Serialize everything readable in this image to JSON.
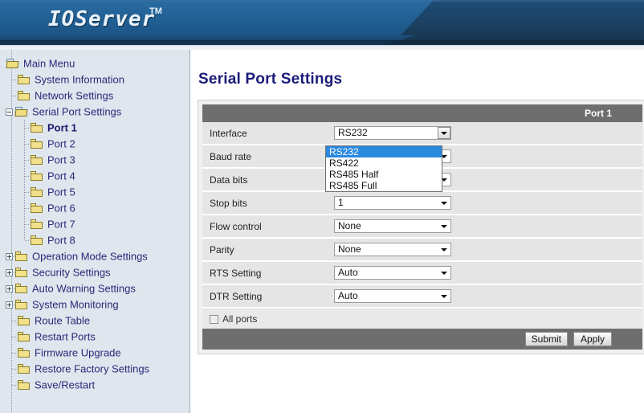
{
  "header": {
    "logo_text": "IOServer",
    "trademark": "TM"
  },
  "sidebar": {
    "items": [
      {
        "label": "Main Menu",
        "level": 0,
        "icon": "open-folder-icon",
        "expander": "none",
        "selected": false
      },
      {
        "label": "System Information",
        "level": 1,
        "icon": "folder-icon",
        "expander": "none",
        "selected": false
      },
      {
        "label": "Network Settings",
        "level": 1,
        "icon": "folder-icon",
        "expander": "none",
        "selected": false
      },
      {
        "label": "Serial Port Settings",
        "level": 1,
        "icon": "open-folder-icon",
        "expander": "minus",
        "selected": false
      },
      {
        "label": "Port 1",
        "level": 2,
        "icon": "folder-icon",
        "expander": "none",
        "selected": true
      },
      {
        "label": "Port 2",
        "level": 2,
        "icon": "folder-icon",
        "expander": "none",
        "selected": false
      },
      {
        "label": "Port 3",
        "level": 2,
        "icon": "folder-icon",
        "expander": "none",
        "selected": false
      },
      {
        "label": "Port 4",
        "level": 2,
        "icon": "folder-icon",
        "expander": "none",
        "selected": false
      },
      {
        "label": "Port 5",
        "level": 2,
        "icon": "folder-icon",
        "expander": "none",
        "selected": false
      },
      {
        "label": "Port 6",
        "level": 2,
        "icon": "folder-icon",
        "expander": "none",
        "selected": false
      },
      {
        "label": "Port 7",
        "level": 2,
        "icon": "folder-icon",
        "expander": "none",
        "selected": false
      },
      {
        "label": "Port 8",
        "level": 2,
        "icon": "folder-icon",
        "expander": "none",
        "selected": false
      },
      {
        "label": "Operation Mode Settings",
        "level": 1,
        "icon": "folder-icon",
        "expander": "plus",
        "selected": false
      },
      {
        "label": "Security Settings",
        "level": 1,
        "icon": "folder-icon",
        "expander": "plus",
        "selected": false
      },
      {
        "label": "Auto Warning Settings",
        "level": 1,
        "icon": "folder-icon",
        "expander": "plus",
        "selected": false
      },
      {
        "label": "System Monitoring",
        "level": 1,
        "icon": "folder-icon",
        "expander": "plus",
        "selected": false
      },
      {
        "label": "Route Table",
        "level": 1,
        "icon": "folder-icon",
        "expander": "none",
        "selected": false
      },
      {
        "label": "Restart Ports",
        "level": 1,
        "icon": "folder-icon",
        "expander": "none",
        "selected": false
      },
      {
        "label": "Firmware Upgrade",
        "level": 1,
        "icon": "folder-icon",
        "expander": "none",
        "selected": false
      },
      {
        "label": "Restore Factory Settings",
        "level": 1,
        "icon": "folder-icon",
        "expander": "none",
        "selected": false
      },
      {
        "label": "Save/Restart",
        "level": 1,
        "icon": "folder-icon",
        "expander": "none",
        "selected": false
      }
    ]
  },
  "main": {
    "page_title": "Serial Port Settings",
    "panel_header": "Port 1",
    "rows": [
      {
        "label": "Interface",
        "value": "RS232",
        "field": "select-open"
      },
      {
        "label": "Baud rate",
        "value": "",
        "field": "select"
      },
      {
        "label": "Data bits",
        "value": "",
        "field": "select"
      },
      {
        "label": "Stop bits",
        "value": "1",
        "field": "select"
      },
      {
        "label": "Flow control",
        "value": "None",
        "field": "select"
      },
      {
        "label": "Parity",
        "value": "None",
        "field": "select"
      },
      {
        "label": "RTS Setting",
        "value": "Auto",
        "field": "select"
      },
      {
        "label": "DTR Setting",
        "value": "Auto",
        "field": "select"
      }
    ],
    "interface_options": [
      {
        "label": "RS232",
        "selected": true
      },
      {
        "label": "RS422",
        "selected": false
      },
      {
        "label": "RS485 Half",
        "selected": false
      },
      {
        "label": "RS485 Full",
        "selected": false
      }
    ],
    "all_ports_label": "All ports",
    "all_ports_checked": false,
    "submit_label": "Submit",
    "apply_label": "Apply"
  },
  "colors": {
    "header_blue": "#2a6ca3",
    "header_navy": "#1b3f5e",
    "sidebar_bg": "#dfe6ed",
    "panel_gray": "#6e6e6e",
    "row_gray": "#e5e5e5",
    "title_navy": "#1b1b7a",
    "highlight_blue": "#2a8ae0"
  }
}
